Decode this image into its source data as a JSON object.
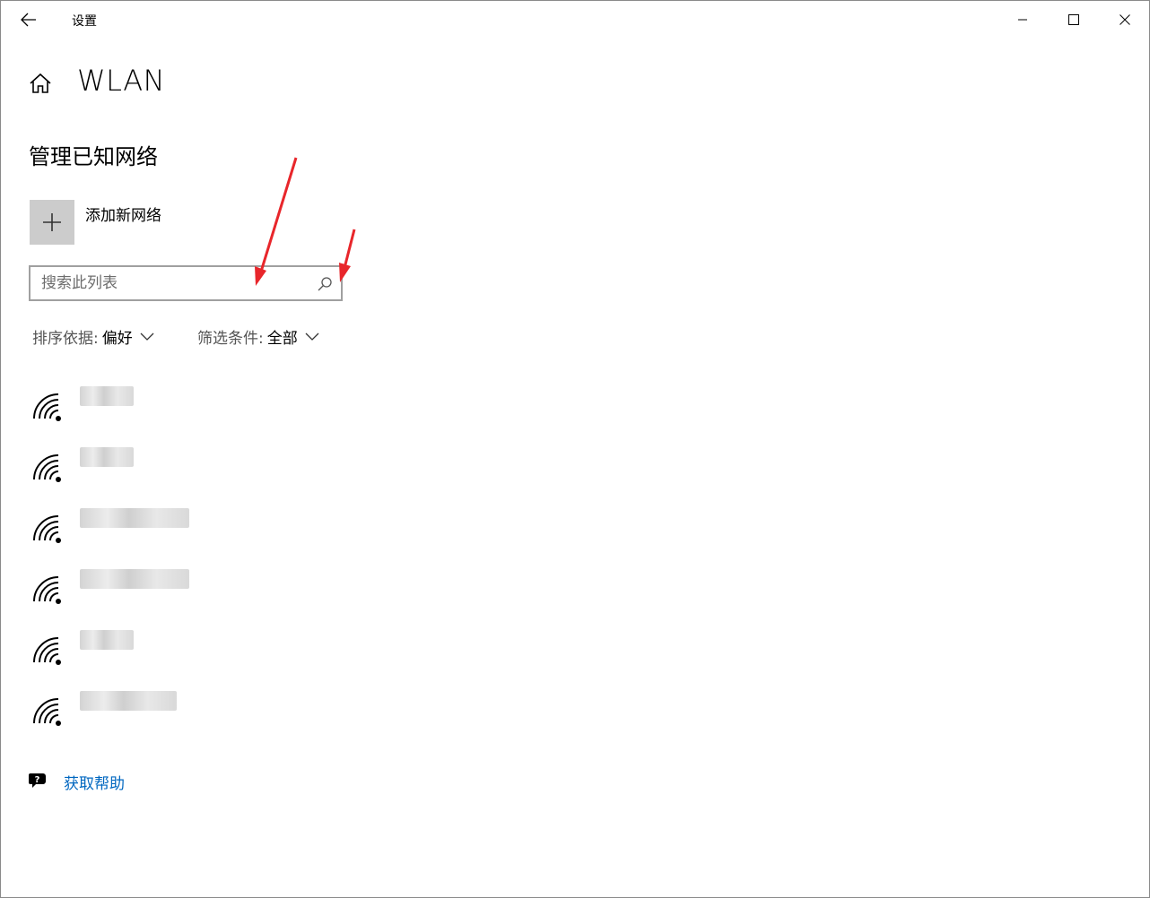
{
  "window": {
    "title": "设置"
  },
  "header": {
    "title": "WLAN"
  },
  "section": {
    "title": "管理已知网络"
  },
  "add_network": {
    "label": "添加新网络"
  },
  "search": {
    "placeholder": "搜索此列表",
    "value": ""
  },
  "sort": {
    "label": "排序依据:",
    "value": "偏好"
  },
  "filter": {
    "label": "筛选条件:",
    "value": "全部"
  },
  "networks": [
    {
      "name": "",
      "icon": "wifi-icon"
    },
    {
      "name": "",
      "icon": "wifi-icon"
    },
    {
      "name": "",
      "icon": "wifi-icon"
    },
    {
      "name": "",
      "icon": "wifi-icon"
    },
    {
      "name": "",
      "icon": "wifi-icon"
    },
    {
      "name": "",
      "icon": "wifi-icon"
    }
  ],
  "help": {
    "label": "获取帮助"
  },
  "colors": {
    "link": "#0067c0",
    "add_tile": "#cccccc",
    "annotation_arrow": "#e8262b"
  }
}
